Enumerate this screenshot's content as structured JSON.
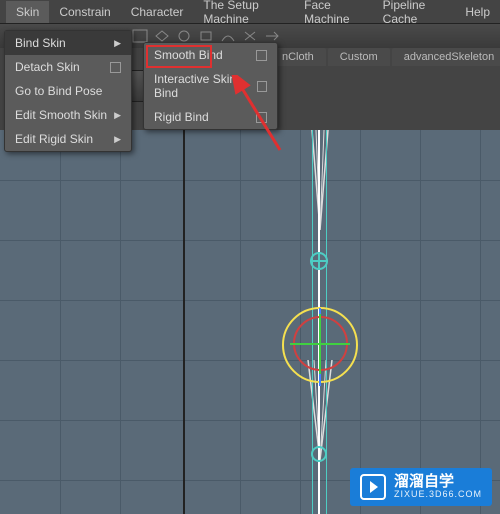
{
  "menubar": {
    "items": [
      "Skin",
      "Constrain",
      "Character",
      "The Setup Machine",
      "Face Machine",
      "Pipeline Cache",
      "Help"
    ]
  },
  "shelf_tabs": [
    "nCloth",
    "Custom",
    "advancedSkeleton"
  ],
  "skin_menu": {
    "items": [
      {
        "label": "Bind Skin",
        "has_submenu": true,
        "highlighted": true
      },
      {
        "label": "Detach Skin",
        "has_checkbox": true
      },
      {
        "label": "Go to Bind Pose"
      },
      {
        "label": "Edit Smooth Skin",
        "has_submenu": true
      },
      {
        "label": "Edit Rigid Skin",
        "has_submenu": true
      }
    ]
  },
  "bind_submenu": {
    "items": [
      {
        "label": "Smooth Bind",
        "has_checkbox": true,
        "boxed": true
      },
      {
        "label": "Interactive Skin Bind",
        "has_checkbox": true
      },
      {
        "label": "Rigid Bind",
        "has_checkbox": true
      }
    ]
  },
  "watermark": {
    "main": "溜溜自学",
    "sub": "ZIXUE.3D66.COM"
  }
}
